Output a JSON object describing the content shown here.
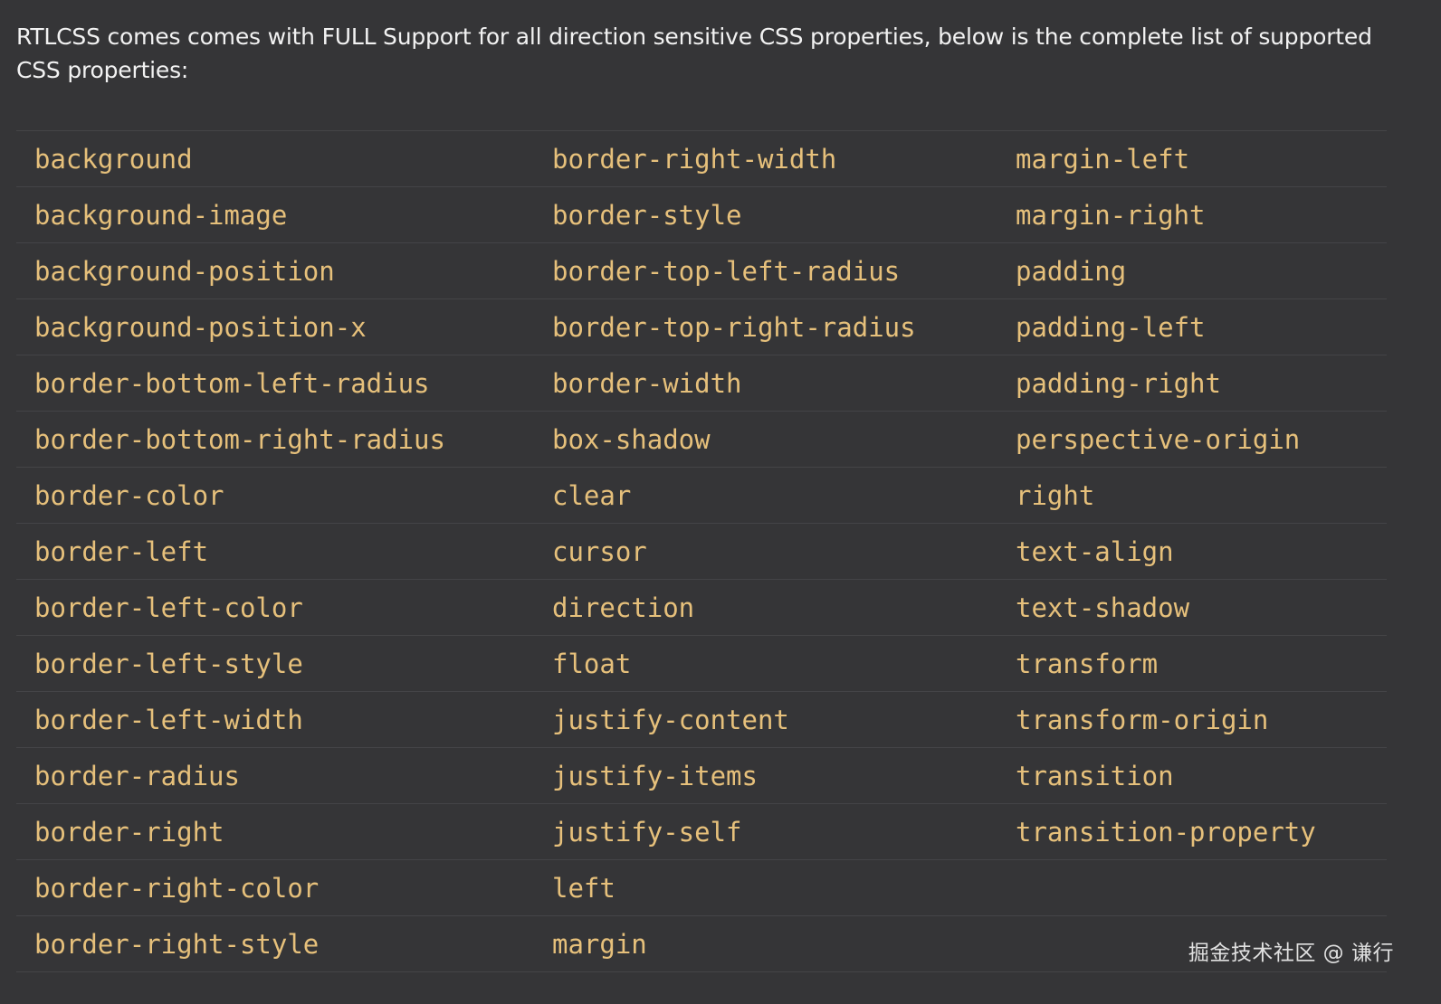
{
  "intro_text": "RTLCSS comes comes with FULL Support for all direction sensitive CSS properties, below is the complete list of supported CSS properties:",
  "properties": {
    "rows": [
      [
        "background",
        "border-right-width",
        "margin-left"
      ],
      [
        "background-image",
        "border-style",
        "margin-right"
      ],
      [
        "background-position",
        "border-top-left-radius",
        "padding"
      ],
      [
        "background-position-x",
        "border-top-right-radius",
        "padding-left"
      ],
      [
        "border-bottom-left-radius",
        "border-width",
        "padding-right"
      ],
      [
        "border-bottom-right-radius",
        "box-shadow",
        "perspective-origin"
      ],
      [
        "border-color",
        "clear",
        "right"
      ],
      [
        "border-left",
        "cursor",
        "text-align"
      ],
      [
        "border-left-color",
        "direction",
        "text-shadow"
      ],
      [
        "border-left-style",
        "float",
        "transform"
      ],
      [
        "border-left-width",
        "justify-content",
        "transform-origin"
      ],
      [
        "border-radius",
        "justify-items",
        "transition"
      ],
      [
        "border-right",
        "justify-self",
        "transition-property"
      ],
      [
        "border-right-color",
        "left",
        ""
      ],
      [
        "border-right-style",
        "margin",
        ""
      ]
    ]
  },
  "watermark": "掘金技术社区 @ 谦行",
  "colors": {
    "background": "#353537",
    "property_text": "#e6c07b",
    "body_text": "#f2f2f2",
    "row_divider": "#444447"
  }
}
